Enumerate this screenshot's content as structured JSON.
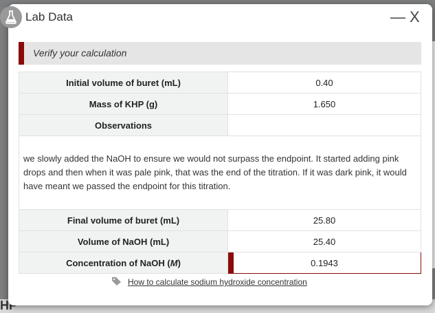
{
  "window": {
    "title": "Lab Data",
    "minimize_label": "—",
    "close_label": "X"
  },
  "banner": {
    "text": "Verify your calculation"
  },
  "table": {
    "rows_top": [
      {
        "label": "Initial volume of buret (mL)",
        "value": "0.40"
      },
      {
        "label": "Mass of KHP (g)",
        "value": "1.650"
      }
    ],
    "observations_label": "Observations",
    "observations_text": "we slowly added the NaOH to ensure we would not surpass the endpoint. It started adding pink drops and then when it was pale pink, that was the end of the titration. If it was dark pink, it would have meant we passed the endpoint for this titration.",
    "rows_bottom": [
      {
        "label": "Final volume of buret (mL)",
        "value": "25.80"
      },
      {
        "label": "Volume of NaOH (mL)",
        "value": "25.40"
      }
    ],
    "concentration": {
      "label_prefix": "Concentration of NaOH (",
      "label_unit": "M",
      "label_suffix": ")",
      "value": "0.1943"
    }
  },
  "help": {
    "icon": "tag-icon",
    "link_text": "How to calculate sodium hydroxide concentration"
  },
  "colors": {
    "accent": "#8b0b0b",
    "label_bg": "#f1f2f2",
    "banner_bg": "#e5e5e5"
  },
  "background": {
    "partial_text": "HP"
  }
}
